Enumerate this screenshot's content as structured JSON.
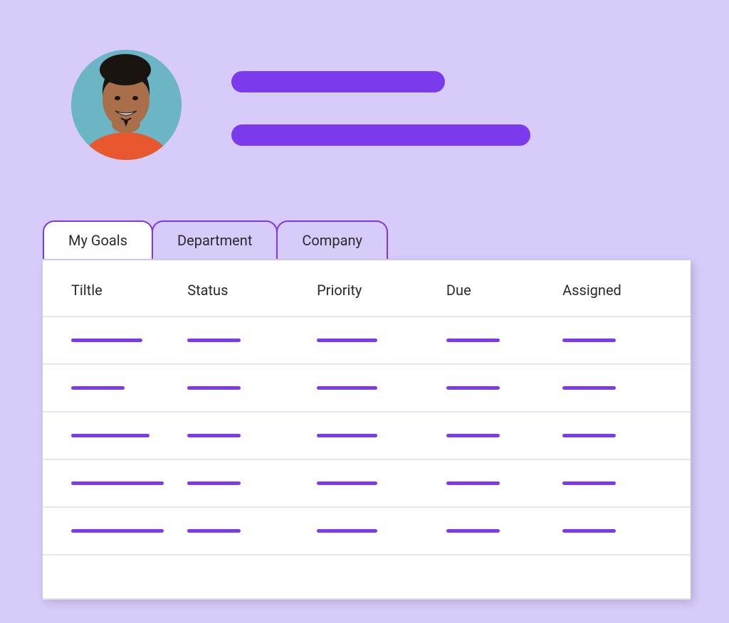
{
  "tabs": [
    {
      "label": "My Goals",
      "active": true
    },
    {
      "label": "Department",
      "active": false
    },
    {
      "label": "Company",
      "active": false
    }
  ],
  "columns": {
    "title": "Tiltle",
    "status": "Status",
    "priority": "Priority",
    "due": "Due",
    "assigned": "Assigned"
  },
  "colors": {
    "accent": "#7c3aed",
    "background": "#d6cbf9",
    "panel": "#ffffff"
  }
}
